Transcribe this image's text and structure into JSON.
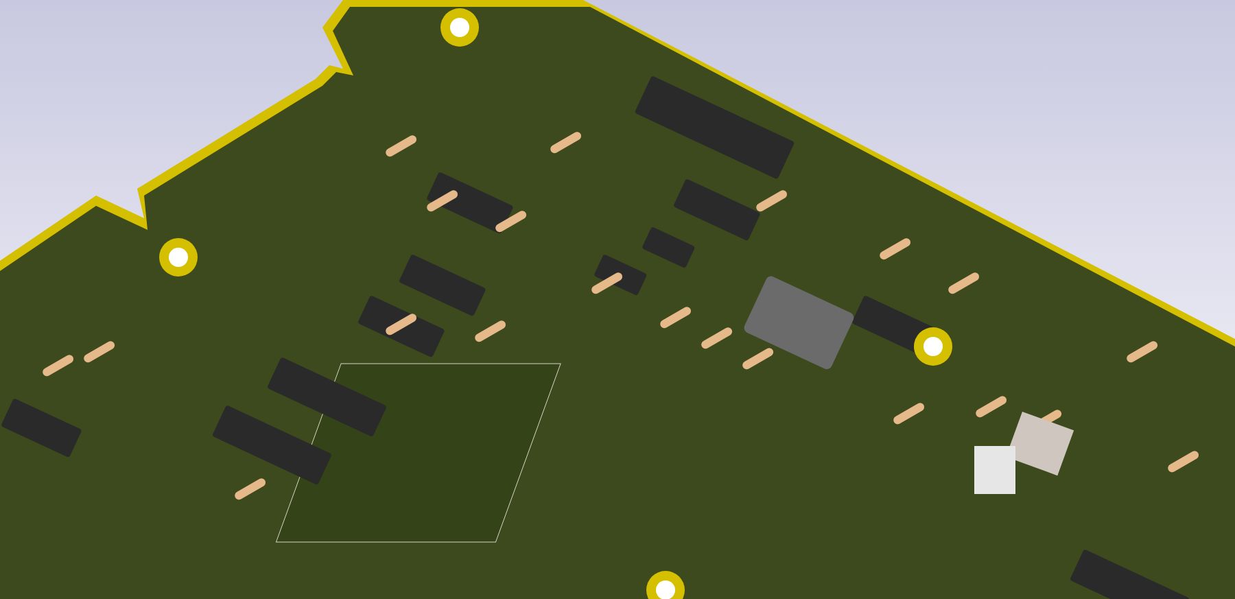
{
  "viewport": {
    "kind": "pcb-3d-render"
  }
}
